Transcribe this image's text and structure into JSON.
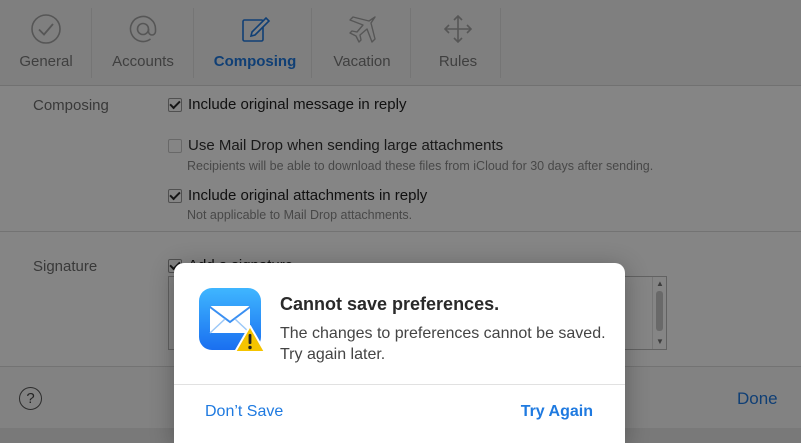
{
  "toolbar": {
    "tabs": [
      {
        "label": "General",
        "icon": "checkmark-circle-icon"
      },
      {
        "label": "Accounts",
        "icon": "at-sign-icon"
      },
      {
        "label": "Composing",
        "icon": "compose-icon",
        "active": true
      },
      {
        "label": "Vacation",
        "icon": "airplane-icon"
      },
      {
        "label": "Rules",
        "icon": "move-arrows-icon"
      }
    ]
  },
  "composing": {
    "section_label": "Composing",
    "options": [
      {
        "label": "Include original message in reply",
        "checked": true
      },
      {
        "label": "Use Mail Drop when sending large attachments",
        "checked": false,
        "hint": "Recipients will be able to download these files from iCloud for 30 days after sending."
      },
      {
        "label": "Include original attachments in reply",
        "checked": true,
        "hint": "Not applicable to Mail Drop attachments."
      }
    ]
  },
  "signature": {
    "section_label": "Signature",
    "add_signature_label": "Add a signature",
    "checked": true
  },
  "footer": {
    "help_label": "?",
    "done_label": "Done"
  },
  "dialog": {
    "title": "Cannot save preferences.",
    "message": "The changes to preferences cannot be saved. Try again later.",
    "secondary_button": "Don’t Save",
    "primary_button": "Try Again",
    "icon": "mail-app-icon",
    "badge_icon": "warning-icon"
  },
  "colors": {
    "accent": "#1f7ae0",
    "overlay": "rgba(0,0,0,0.48)"
  }
}
